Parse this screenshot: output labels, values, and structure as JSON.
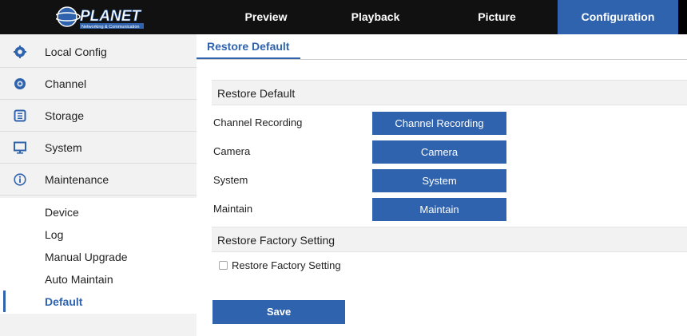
{
  "header": {
    "logo_text": "PLANET",
    "logo_subtext": "Networking & Communication",
    "tabs": [
      {
        "label": "Preview",
        "active": false
      },
      {
        "label": "Playback",
        "active": false
      },
      {
        "label": "Picture",
        "active": false
      },
      {
        "label": "Configuration",
        "active": true
      }
    ]
  },
  "sidebar": {
    "items": [
      {
        "label": "Local Config",
        "icon": "gear-icon"
      },
      {
        "label": "Channel",
        "icon": "camera-lens-icon"
      },
      {
        "label": "Storage",
        "icon": "storage-icon"
      },
      {
        "label": "System",
        "icon": "monitor-icon"
      },
      {
        "label": "Maintenance",
        "icon": "info-icon"
      }
    ],
    "sub_items": [
      {
        "label": "Device"
      },
      {
        "label": "Log"
      },
      {
        "label": "Manual Upgrade"
      },
      {
        "label": "Auto Maintain"
      },
      {
        "label": "Default",
        "active": true
      }
    ]
  },
  "main": {
    "page_tab": "Restore Default",
    "restore_section": {
      "title": "Restore Default",
      "rows": [
        {
          "label": "Channel Recording",
          "button": "Channel Recording"
        },
        {
          "label": "Camera",
          "button": "Camera"
        },
        {
          "label": "System",
          "button": "System"
        },
        {
          "label": "Maintain",
          "button": "Maintain"
        }
      ]
    },
    "factory_section": {
      "title": "Restore Factory Setting",
      "checkbox_label": "Restore Factory Setting",
      "checkbox_checked": false
    },
    "save_label": "Save"
  },
  "colors": {
    "accent": "#2f63ad",
    "topbar": "#111111",
    "sidebar_bg": "#f2f2f2"
  }
}
